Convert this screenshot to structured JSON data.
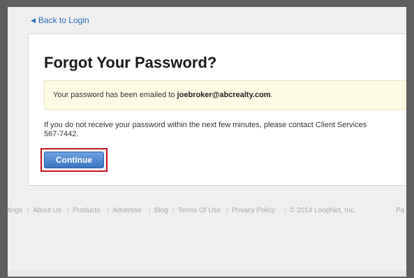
{
  "nav": {
    "back_label": "Back to Login"
  },
  "page": {
    "title": "Forgot Your Password?",
    "notice_prefix": "Your password has been emailed to ",
    "email": "joebroker@abcrealty.com",
    "notice_suffix": ".",
    "info_line1": "If you do not receive your password within the next few minutes, please contact Client Services",
    "info_line2": "567-7442.",
    "continue_label": "Continue"
  },
  "footer": {
    "links": [
      "tings",
      "About Us",
      "Products",
      "Advertise",
      "Blog",
      "Terms Of Use",
      "Privacy Policy"
    ],
    "copyright": "© 2014 LoopNet, Inc.",
    "trailing": "Pa"
  },
  "colors": {
    "link": "#2a6ebb",
    "button": "#3c74c0",
    "highlight_outline": "#c1121a",
    "notice_bg": "#fcfbe4"
  }
}
